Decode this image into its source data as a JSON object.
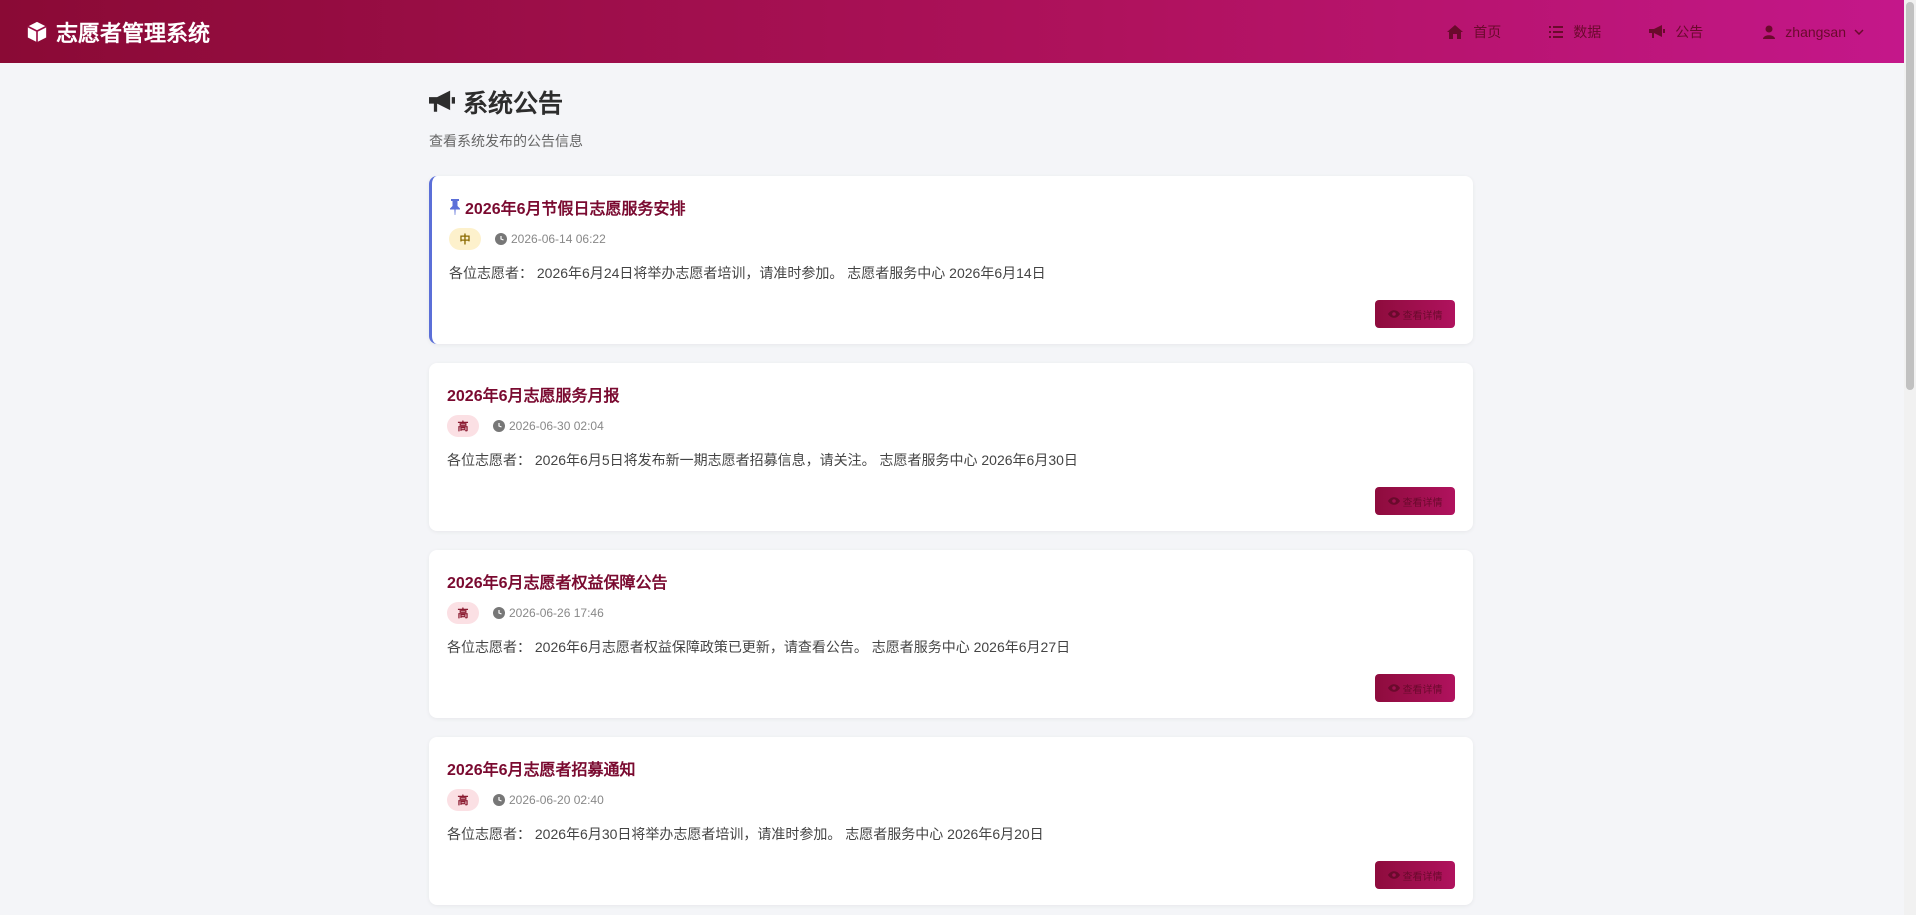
{
  "app": {
    "title": "志愿者管理系统"
  },
  "nav": {
    "home": "首页",
    "data": "数据",
    "notice": "公告",
    "user": "zhangsan"
  },
  "page": {
    "title": "系统公告",
    "subtitle": "查看系统发布的公告信息"
  },
  "colors": {
    "brand_start": "#8a0a35",
    "brand_end": "#c4178a",
    "title": "#7a0a30",
    "pin_border": "#5b6fd8"
  },
  "notices": [
    {
      "title": "2026年6月节假日志愿服务安排",
      "pinned": true,
      "priority": "中",
      "time": "2026-06-14 06:22",
      "body": "各位志愿者：  2026年6月24日将举办志愿者培训，请准时参加。 志愿者服务中心 2026年6月14日",
      "button": "查看详情"
    },
    {
      "title": "2026年6月志愿服务月报",
      "pinned": false,
      "priority": "高",
      "time": "2026-06-30 02:04",
      "body": "各位志愿者：  2026年6月5日将发布新一期志愿者招募信息，请关注。 志愿者服务中心 2026年6月30日",
      "button": "查看详情"
    },
    {
      "title": "2026年6月志愿者权益保障公告",
      "pinned": false,
      "priority": "高",
      "time": "2026-06-26 17:46",
      "body": "各位志愿者：  2026年6月志愿者权益保障政策已更新，请查看公告。 志愿者服务中心 2026年6月27日",
      "button": "查看详情"
    },
    {
      "title": "2026年6月志愿者招募通知",
      "pinned": false,
      "priority": "高",
      "time": "2026-06-20 02:40",
      "body": "各位志愿者：  2026年6月30日将举办志愿者培训，请准时参加。 志愿者服务中心 2026年6月20日",
      "button": "查看详情"
    }
  ]
}
